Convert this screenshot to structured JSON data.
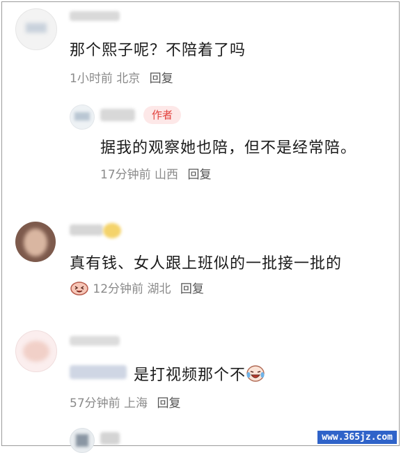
{
  "comments": [
    {
      "text": "那个熙子呢？不陪着了吗",
      "time": "1小时前",
      "location": "北京",
      "reply_label": "回复"
    },
    {
      "author_tag": "作者",
      "text": "据我的观察她也陪，但不是经常陪。",
      "time": "17分钟前",
      "location": "山西",
      "reply_label": "回复"
    },
    {
      "text": "真有钱、女人跟上班似的一批接一批的",
      "time": "12分钟前",
      "location": "湖北",
      "reply_label": "回复",
      "badge_icon": "laughing-face-icon"
    },
    {
      "text": "是打视频那个不",
      "time": "57分钟前",
      "location": "上海",
      "reply_label": "回复",
      "trailing_icon": "crying-laughing-face-icon"
    }
  ],
  "watermark": "www.365jz.com"
}
